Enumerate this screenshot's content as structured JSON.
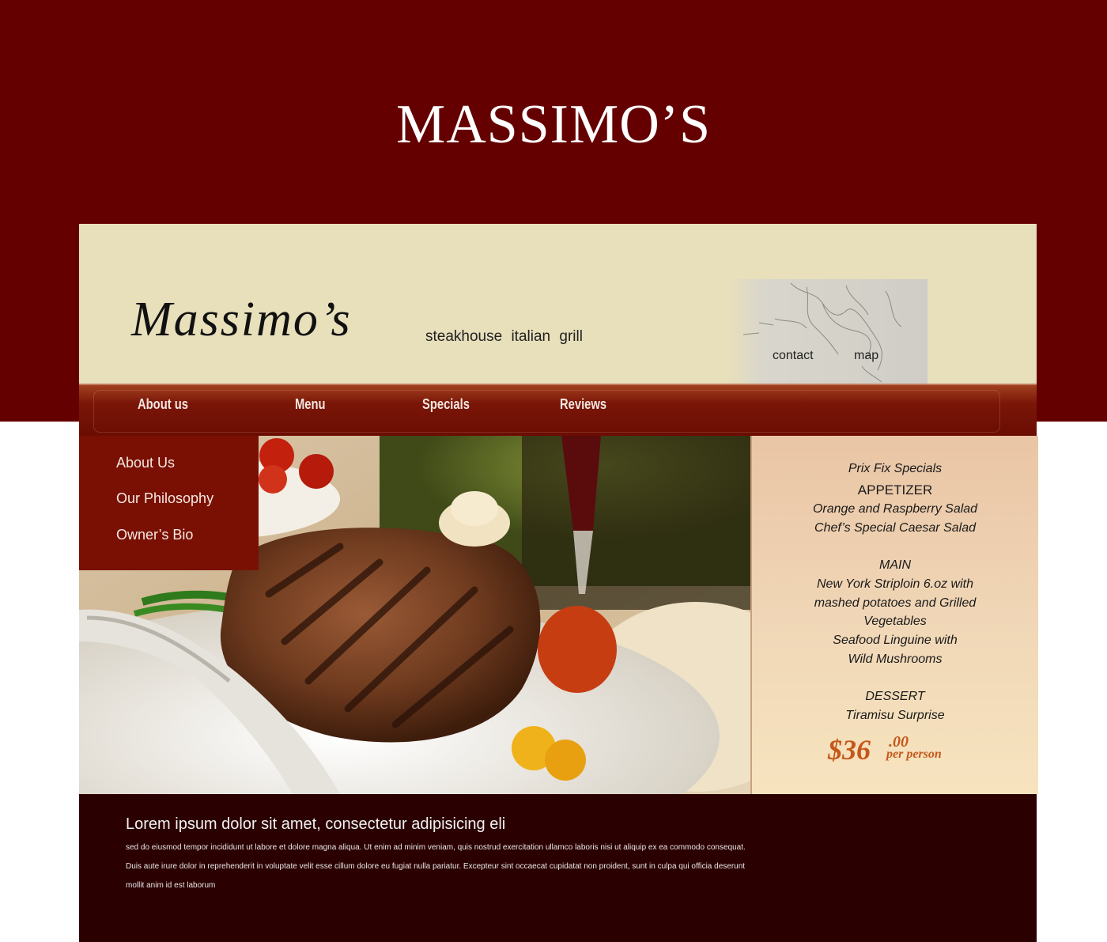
{
  "page": {
    "title": "MASSIMO’S"
  },
  "site": {
    "logo": "Massimo’s",
    "tagline": "steakhouse  italian grill",
    "header_links": {
      "contact": "contact",
      "map": "map"
    },
    "nav": [
      "About us",
      "Menu",
      "Specials",
      "Reviews"
    ],
    "side_menu": [
      "About Us",
      "Our Philosophy",
      "Owner’s Bio"
    ],
    "specials": {
      "heading": "Prix Fix Specials",
      "appetizer_title": "APPETIZER",
      "appetizer_items": [
        "Orange and Raspberry Salad",
        "Chef’s Special Caesar Salad"
      ],
      "main_title": "MAIN",
      "main_items": [
        "New York Striploin 6.oz with",
        "mashed potatoes and Grilled",
        "Vegetables",
        "Seafood Linguine with",
        "Wild Mushrooms"
      ],
      "dessert_title": "DESSERT",
      "dessert_items": [
        "Tiramisu Surprise"
      ],
      "price_dollars": "$36",
      "price_cents": ".00",
      "price_unit": "per person"
    },
    "footer": {
      "heading": "Lorem ipsum dolor sit amet, consectetur adipisicing eli",
      "body": "sed do eiusmod tempor incididunt ut labore et dolore magna aliqua. Ut enim ad minim veniam, quis nostrud exercitation ullamco laboris nisi ut aliquip ex ea commodo consequat. Duis aute irure dolor in reprehenderit in voluptate velit esse cillum dolore eu fugiat nulla pariatur. Excepteur sint occaecat cupidatat non proident, sunt in culpa qui officia deserunt mollit anim id est laborum"
    }
  },
  "colors": {
    "brand_dark_red": "#650000",
    "header_cream": "#e8dfbb",
    "nav_red": "#7a1608",
    "price_orange": "#c4581a",
    "footer_maroon": "#2b0000"
  },
  "icons": [
    "map-graphic",
    "steak-photo"
  ]
}
